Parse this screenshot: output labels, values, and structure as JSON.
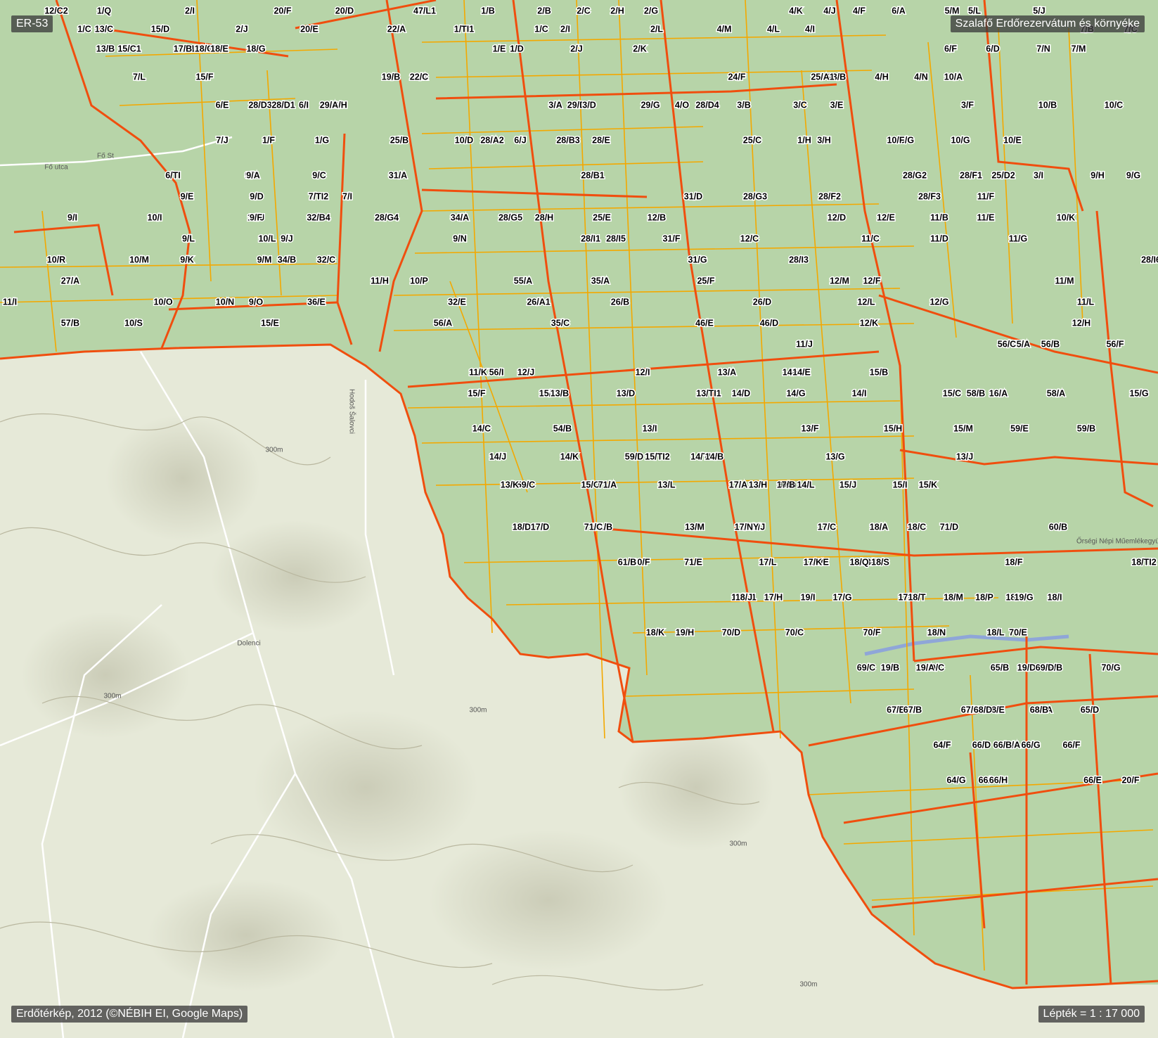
{
  "map_id": "ER-53",
  "title": "Szalafő Erdőrezervátum és környéke",
  "credit": "Erdőtérkép, 2012 (©NÉBIH EI, Google Maps)",
  "scale": "Lépték = 1 : 17 000",
  "colors": {
    "forest": "#b7d4a8",
    "terrain": "#e6e9d8",
    "stand_border": "#f3a800",
    "compartment_border": "#f04e0e",
    "road": "#ffffff",
    "stream": "#8fa6d8",
    "label_text": "#000000",
    "label_halo": "#ffffff"
  },
  "place_names": [
    "Fő utca",
    "Fő St",
    "Hodoš Šalovci",
    "Dolenci",
    "Őrségi Népi Műemlékegyüttes"
  ],
  "contour_labels": [
    "300m"
  ],
  "compartments": [
    "12/C2",
    "1/Q",
    "2/I",
    "20/F",
    "20/D",
    "47/L1",
    "1/B",
    "2/B",
    "2/C",
    "2/H",
    "2/G",
    "4/K",
    "4/J",
    "4/F",
    "6/A",
    "5/M",
    "5/L",
    "5/J",
    "1/C",
    "13/C",
    "15/D",
    "2/J",
    "20/E",
    "22/A",
    "1/TI1",
    "1/C",
    "2/I",
    "2/L",
    "4/M",
    "4/L",
    "4/I",
    "7/B",
    "7/C",
    "15/C1",
    "17/A",
    "17/B",
    "18/D",
    "18/G",
    "18/C",
    "18/E",
    "13/B",
    "1/D",
    "1/E",
    "2/J",
    "2/K",
    "6/F",
    "6/D",
    "7/N",
    "7/M",
    "7/L",
    "15/F",
    "19/B",
    "23/A",
    "22/C",
    "23/B",
    "24/F",
    "25/A1",
    "4/H",
    "4/N",
    "10/A",
    "6/I",
    "6/H",
    "6/E",
    "28/D3",
    "28/D1",
    "29/A",
    "29/D",
    "29/G",
    "28/D4",
    "3/A",
    "3/D",
    "4/O",
    "3/B",
    "3/C",
    "3/E",
    "3/F",
    "10/B",
    "10/C",
    "10/D",
    "6/J",
    "7/O",
    "7/J",
    "1/F",
    "1/G",
    "25/B",
    "28/A2",
    "28/B3",
    "28/E",
    "25/C",
    "1/H",
    "3/H",
    "3/G",
    "10/G",
    "10/F",
    "10/E",
    "6/TI",
    "9/B",
    "9/A",
    "9/C",
    "31/A",
    "28/B1",
    "28/G2",
    "28/F1",
    "25/D2",
    "3/I",
    "9/H",
    "9/G",
    "9/E",
    "9/D",
    "7/TI2",
    "7/I",
    "31/D",
    "28/G3",
    "28/F2",
    "28/F3",
    "11/F",
    "10/I",
    "10/J",
    "9/I",
    "9/F",
    "32/B4",
    "28/G4",
    "34/A",
    "28/G5",
    "28/H",
    "25/E",
    "12/B",
    "12/D",
    "12/E",
    "11/B",
    "11/E",
    "10/K",
    "10/L",
    "9/J",
    "9/L",
    "9/N",
    "28/I1",
    "28/I5",
    "31/F",
    "12/C",
    "11/C",
    "11/D",
    "11/G",
    "10/R",
    "10/M",
    "9/K",
    "9/M",
    "34/B",
    "32/C",
    "31/G",
    "28/I3",
    "28/I6",
    "27/A",
    "11/H",
    "10/P",
    "55/A",
    "35/A",
    "25/F",
    "12/M",
    "12/F",
    "11/M",
    "11/I",
    "10/O",
    "10/N",
    "9/O",
    "36/E",
    "32/E",
    "26/A1",
    "26/B",
    "26/D",
    "12/L",
    "12/G",
    "11/L",
    "10/S",
    "15/E",
    "57/B",
    "56/A",
    "35/C",
    "46/E",
    "46/D",
    "12/K",
    "12/H",
    "11/J",
    "15/A",
    "56/B",
    "56/C",
    "56/F",
    "56/I",
    "12/J",
    "12/I",
    "11/K",
    "13/A",
    "14/H",
    "14/E",
    "15/B",
    "15/D",
    "15/F",
    "13/B",
    "13/D",
    "13/TI1",
    "14/D",
    "14/G",
    "14/I",
    "15/C",
    "16/A",
    "58/A",
    "58/B",
    "15/G",
    "54/B",
    "13/I",
    "14/C",
    "13/F",
    "15/H",
    "15/M",
    "59/B",
    "59/E",
    "59/D",
    "14/TI1",
    "14/J",
    "13/G",
    "15/TI2",
    "14/B",
    "14/K",
    "13/J",
    "59/C",
    "13/H",
    "14/L",
    "15/I",
    "15/O",
    "13/K",
    "71/A",
    "13/L",
    "17/A",
    "17/B",
    "15/J",
    "15/K",
    "15/L",
    "17/C",
    "18/A",
    "18/C",
    "18/D",
    "71/B",
    "13/M",
    "17/J",
    "17/NY",
    "17/D",
    "71/C",
    "71/D",
    "60/B",
    "60/F",
    "17/L",
    "17/E",
    "18/R",
    "18/Q",
    "18/F",
    "18/TI2",
    "61/B",
    "71/E",
    "17/K",
    "18/S",
    "18/TI1",
    "17/H",
    "17/F",
    "18/G",
    "19/G",
    "18/I",
    "18/J",
    "19/I",
    "17/G",
    "18/T",
    "18/P",
    "18/M",
    "19/H",
    "70/D",
    "70/E",
    "18/K",
    "70/C",
    "70/F",
    "18/N",
    "18/L",
    "19/D",
    "70/G",
    "19/C",
    "19/B",
    "69/C",
    "19/A",
    "65/B",
    "69/B",
    "69/D",
    "65/D",
    "67/E",
    "67/F",
    "67/A",
    "68/B",
    "68/E",
    "67/C",
    "67/B",
    "68/D",
    "64/F",
    "66/A",
    "66/F",
    "66/D",
    "66/G",
    "66/B",
    "66/E",
    "64/G",
    "66/I",
    "20/F",
    "66/H"
  ]
}
